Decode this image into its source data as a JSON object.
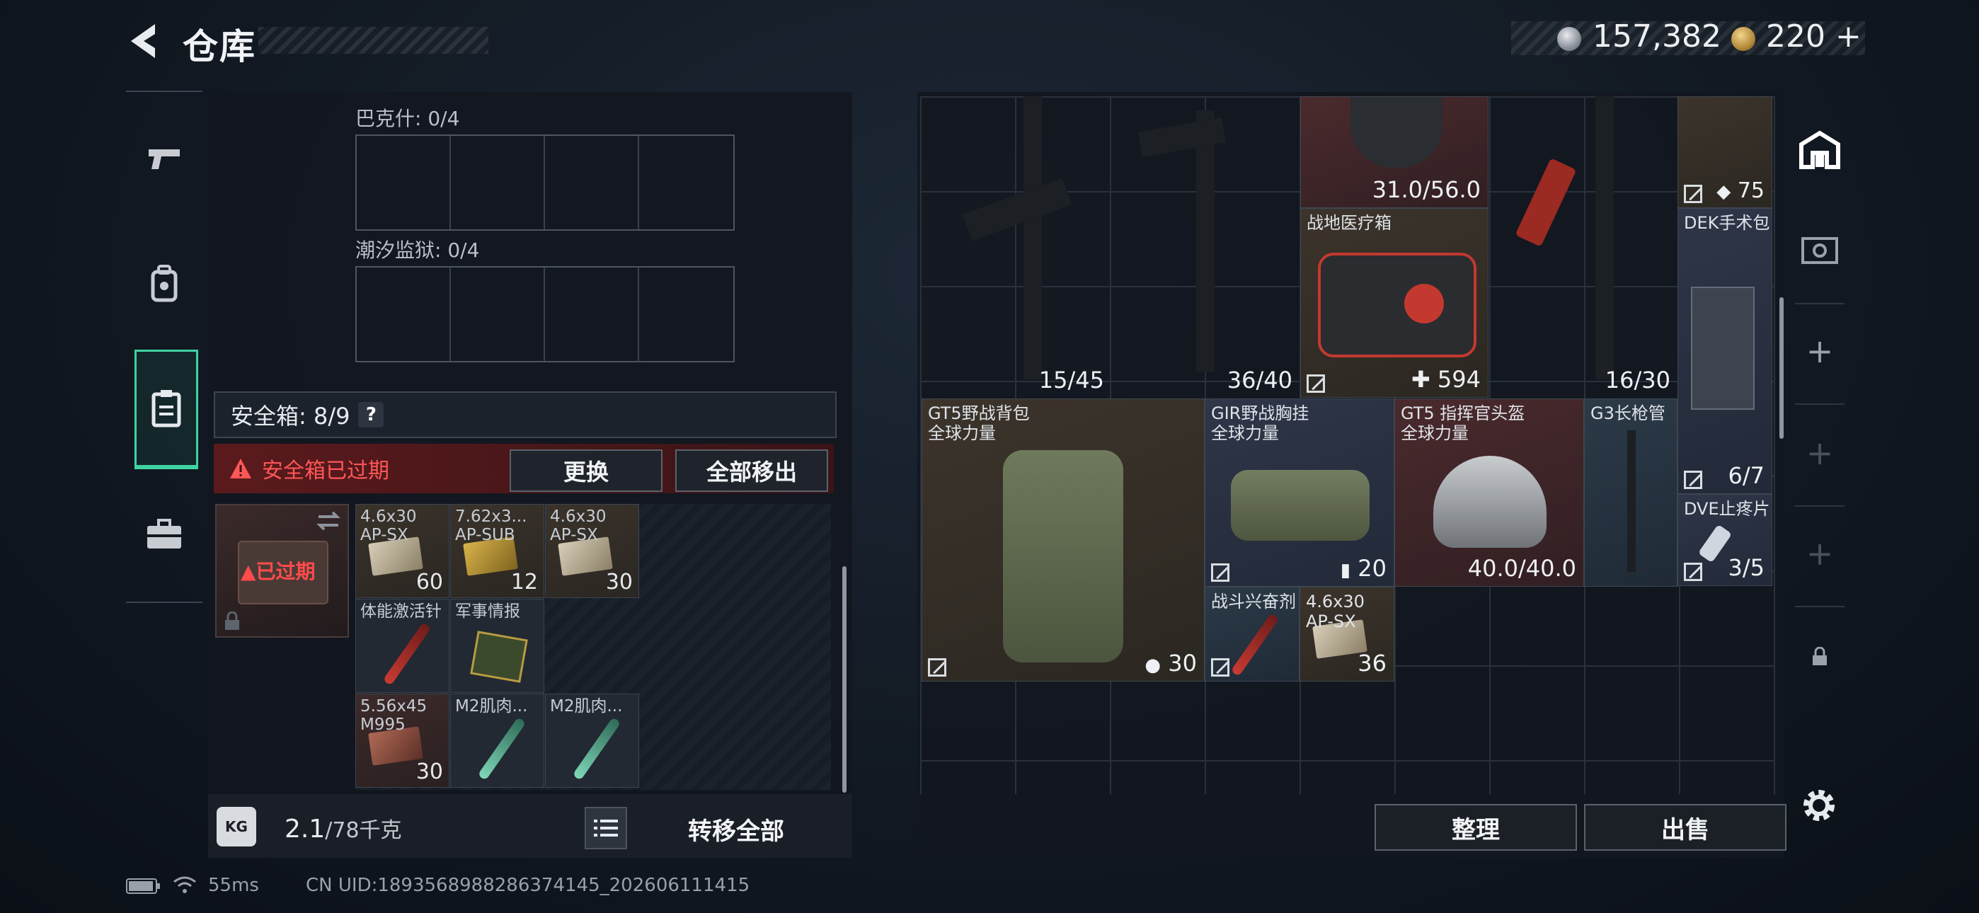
{
  "header": {
    "title": "仓库",
    "currency_silver": "157,382",
    "currency_gold": "220",
    "add_symbol": "+"
  },
  "left_panel": {
    "container1_label": "巴克什: 0/4",
    "container2_label": "潮汐监狱: 0/4",
    "safe_box_label": "安全箱: 8/9",
    "help_symbol": "?",
    "expired_warning": "安全箱已过期",
    "replace_button": "更换",
    "remove_all_button": "全部移出",
    "case_expired_text": "已过期",
    "items": [
      {
        "name": "4.6x30\nAP-SX",
        "count": "60",
        "style": "brown",
        "icon": "ammo"
      },
      {
        "name": "7.62x3...\nAP-SUB",
        "count": "12",
        "style": "brown",
        "icon": "ammo"
      },
      {
        "name": "4.6x30\nAP-SX",
        "count": "30",
        "style": "brown",
        "icon": "ammo"
      },
      {
        "name": "体能激活针",
        "count": "",
        "style": "dark",
        "icon": "syringe-red"
      },
      {
        "name": "军事情报",
        "count": "",
        "style": "dark",
        "icon": "board"
      },
      {
        "name": "5.56x45\nM995",
        "count": "30",
        "style": "red",
        "icon": "ammo"
      },
      {
        "name": "M2肌肉...",
        "count": "",
        "style": "dark",
        "icon": "syringe-green"
      },
      {
        "name": "M2肌肉...",
        "count": "",
        "style": "dark",
        "icon": "syringe-green"
      }
    ],
    "weight_value": "2.1",
    "weight_total": "/78千克",
    "kg_icon_text": "KG",
    "transfer_all": "转移全部"
  },
  "right_panel": {
    "items": {
      "rifle1_count": "15/45",
      "rifle2_count": "36/40",
      "helmet_top_count": "31.0/56.0",
      "rifle3_count": "16/30",
      "armor_count": "75",
      "medkit_name": "战地医疗箱",
      "medkit_count": "594",
      "dek_name": "DEK手术包",
      "dek_count": "6/7",
      "backpack_name": "GT5野战背包\n全球力量",
      "backpack_count": "30",
      "chest_name": "GIR野战胸挂\n全球力量",
      "chest_count": "20",
      "helmet_name": "GT5 指挥官头盔\n全球力量",
      "helmet_count": "40.0/40.0",
      "g3_name": "G3长枪管",
      "dve_name": "DVE止疼片",
      "dve_count": "3/5",
      "stim_name": "战斗兴奋剂",
      "ammo_name": "4.6x30\nAP-SX",
      "ammo_count": "36"
    },
    "sort_button": "整理",
    "sell_button": "出售"
  },
  "right_nav": {
    "add1": "+",
    "add2": "+",
    "add3": "+"
  },
  "status_bar": {
    "ping": "55ms",
    "uid": "CN UID:1893568988286374145_202606111415"
  },
  "colors": {
    "accent_green": "#3fd3a2",
    "warning_red": "#ff5656"
  }
}
